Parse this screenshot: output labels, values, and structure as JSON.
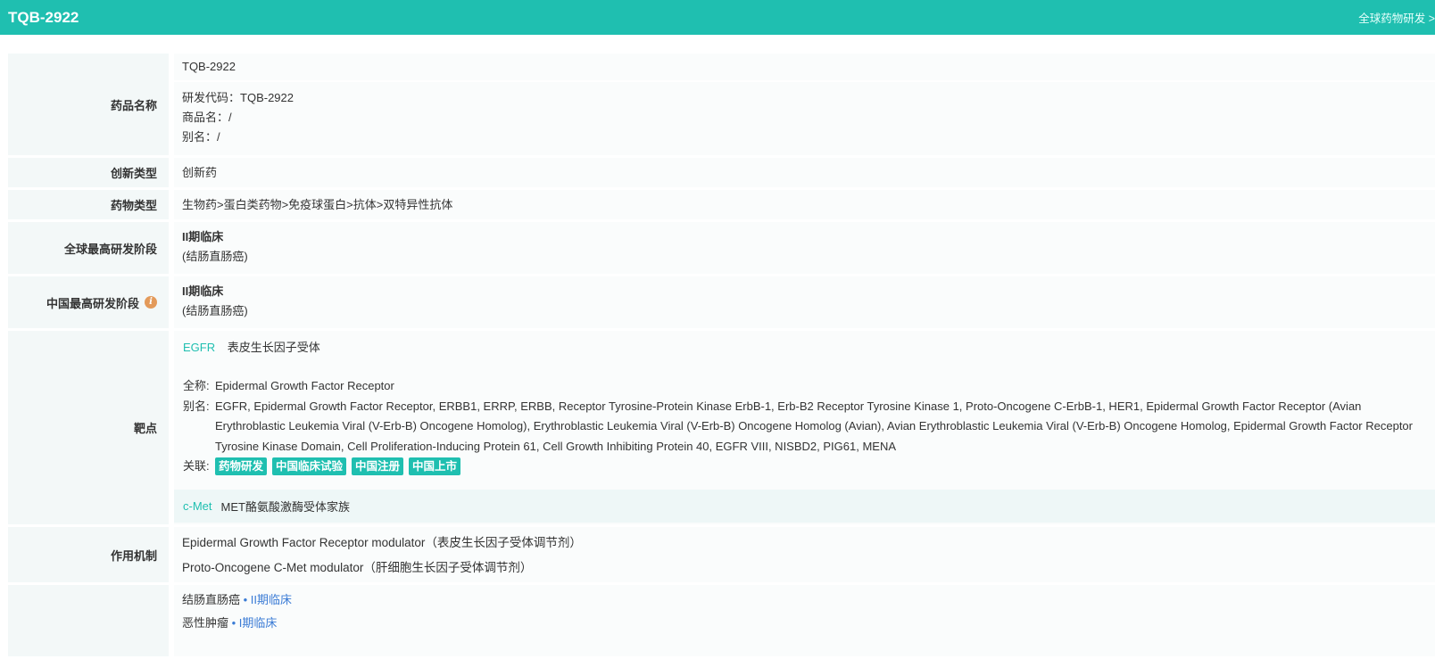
{
  "header": {
    "title": "TQB-2922",
    "link": "全球药物研发 >"
  },
  "drug_name": {
    "label": "药品名称",
    "name": "TQB-2922",
    "code_label": "研发代码：",
    "code": "TQB-2922",
    "trade_label": "商品名：",
    "trade": "/",
    "alias_label": "别名：",
    "alias": "/"
  },
  "innovation": {
    "label": "创新类型",
    "value": "创新药"
  },
  "drug_type": {
    "label": "药物类型",
    "value": "生物药>蛋白类药物>免疫球蛋白>抗体>双特异性抗体"
  },
  "global_stage": {
    "label": "全球最高研发阶段",
    "stage": "II期临床",
    "indication": "(结肠直肠癌)"
  },
  "china_stage": {
    "label": "中国最高研发阶段",
    "icon": "info-icon",
    "stage": "II期临床",
    "indication": "(结肠直肠癌)"
  },
  "targets": {
    "label": "靶点",
    "items": [
      {
        "code": "EGFR",
        "name": "表皮生长因子受体",
        "fullname_label": "全称:",
        "fullname": "Epidermal Growth Factor Receptor",
        "alias_label": "别名:",
        "alias": "EGFR, Epidermal Growth Factor Receptor, ERBB1, ERRP, ERBB, Receptor Tyrosine-Protein Kinase ErbB-1, Erb-B2 Receptor Tyrosine Kinase 1, Proto-Oncogene C-ErbB-1, HER1, Epidermal Growth Factor Receptor (Avian Erythroblastic Leukemia Viral (V-Erb-B) Oncogene Homolog), Erythroblastic Leukemia Viral (V-Erb-B) Oncogene Homolog (Avian), Avian Erythroblastic Leukemia Viral (V-Erb-B) Oncogene Homolog, Epidermal Growth Factor Receptor Tyrosine Kinase Domain, Cell Proliferation-Inducing Protein 61, Cell Growth Inhibiting Protein 40, EGFR VIII, NISBD2, PIG61, MENA",
        "related_label": "关联:",
        "tags": [
          "药物研发",
          "中国临床试验",
          "中国注册",
          "中国上市"
        ]
      },
      {
        "code": "c-Met",
        "name": "MET酪氨酸激酶受体家族"
      }
    ]
  },
  "mechanism": {
    "label": "作用机制",
    "items": [
      "Epidermal Growth Factor Receptor modulator（表皮生长因子受体调节剂）",
      "Proto-Oncogene C-Met modulator（肝细胞生长因子受体调节剂）"
    ]
  },
  "indications": {
    "items": [
      {
        "name": "结肠直肠癌",
        "stage": "• II期临床"
      },
      {
        "name": "恶性肿瘤",
        "stage": "• I期临床"
      }
    ]
  },
  "colors": {
    "accent": "#1fbfb0",
    "link": "#3a7bd5",
    "label_bg": "#f3f8f8",
    "value_bg": "#fafcfc",
    "info_icon": "#e39a5a"
  }
}
